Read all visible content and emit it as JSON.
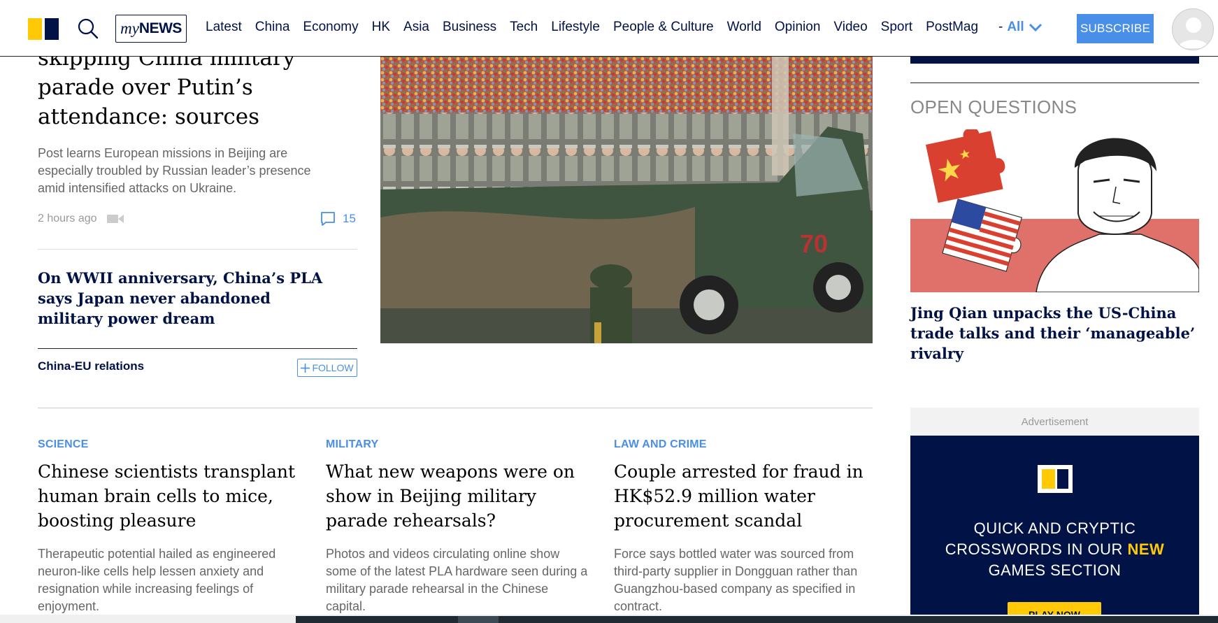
{
  "header": {
    "mynews_my": "my",
    "mynews_news": "NEWS",
    "nav": [
      "Latest",
      "China",
      "Economy",
      "HK",
      "Asia",
      "Business",
      "Tech",
      "Lifestyle",
      "People & Culture",
      "World",
      "Opinion",
      "Video",
      "Sport",
      "PostMag"
    ],
    "nav_more_dash": "-",
    "nav_more_all": "All",
    "subscribe": "SUBSCRIBE"
  },
  "lead": {
    "headline": "skipping China military parade over Putin’s attendance: sources",
    "summary": "Post learns European missions in Beijing are especially troubled by Russian leader’s presence amid intensified attacks on Ukraine.",
    "time": "2 hours ago",
    "comment_count": "15"
  },
  "related": {
    "headline": "On WWII anniversary, China’s PLA says Japan never abandoned military power dream"
  },
  "topic": {
    "name": "China-EU relations",
    "follow_label": "FOLLOW"
  },
  "open_questions": {
    "label": "OPEN QUESTIONS",
    "headline": "Jing Qian unpacks the US-China trade talks and their ‘manageable’ rivalry"
  },
  "ad": {
    "label": "Advertisement",
    "line1": "QUICK AND CRYPTIC",
    "line2_pre": "CROSSWORDS IN OUR ",
    "line2_hl": "NEW",
    "line3": "GAMES SECTION",
    "button": "PLAY NOW"
  },
  "cards": [
    {
      "kicker": "SCIENCE",
      "title": "Chinese scientists transplant human brain cells to mice, boosting pleasure",
      "summary": "Therapeutic potential hailed as engineered neuron-like cells help lessen anxiety and resignation while increasing feelings of enjoyment."
    },
    {
      "kicker": "MILITARY",
      "title": "What new weapons were on show in Beijing military parade rehearsals?",
      "summary": "Photos and videos circulating online show some of the latest PLA hardware seen during a military parade rehearsal in the Chinese capital."
    },
    {
      "kicker": "LAW AND CRIME",
      "title": "Couple arrested for fraud in HK$52.9 million water procurement scandal",
      "summary": "Force says bottled water was sourced from third-party supplier in Dongguan rather than Guangzhou-based company as specified in contract."
    }
  ],
  "colors": {
    "brand_navy": "#001246",
    "brand_yellow": "#FFCA05",
    "accent_blue": "#4A8FE7"
  },
  "icons": [
    "logo",
    "search-icon",
    "chevron-down-icon",
    "user-avatar-icon",
    "video-icon",
    "comment-icon",
    "plus-icon"
  ]
}
